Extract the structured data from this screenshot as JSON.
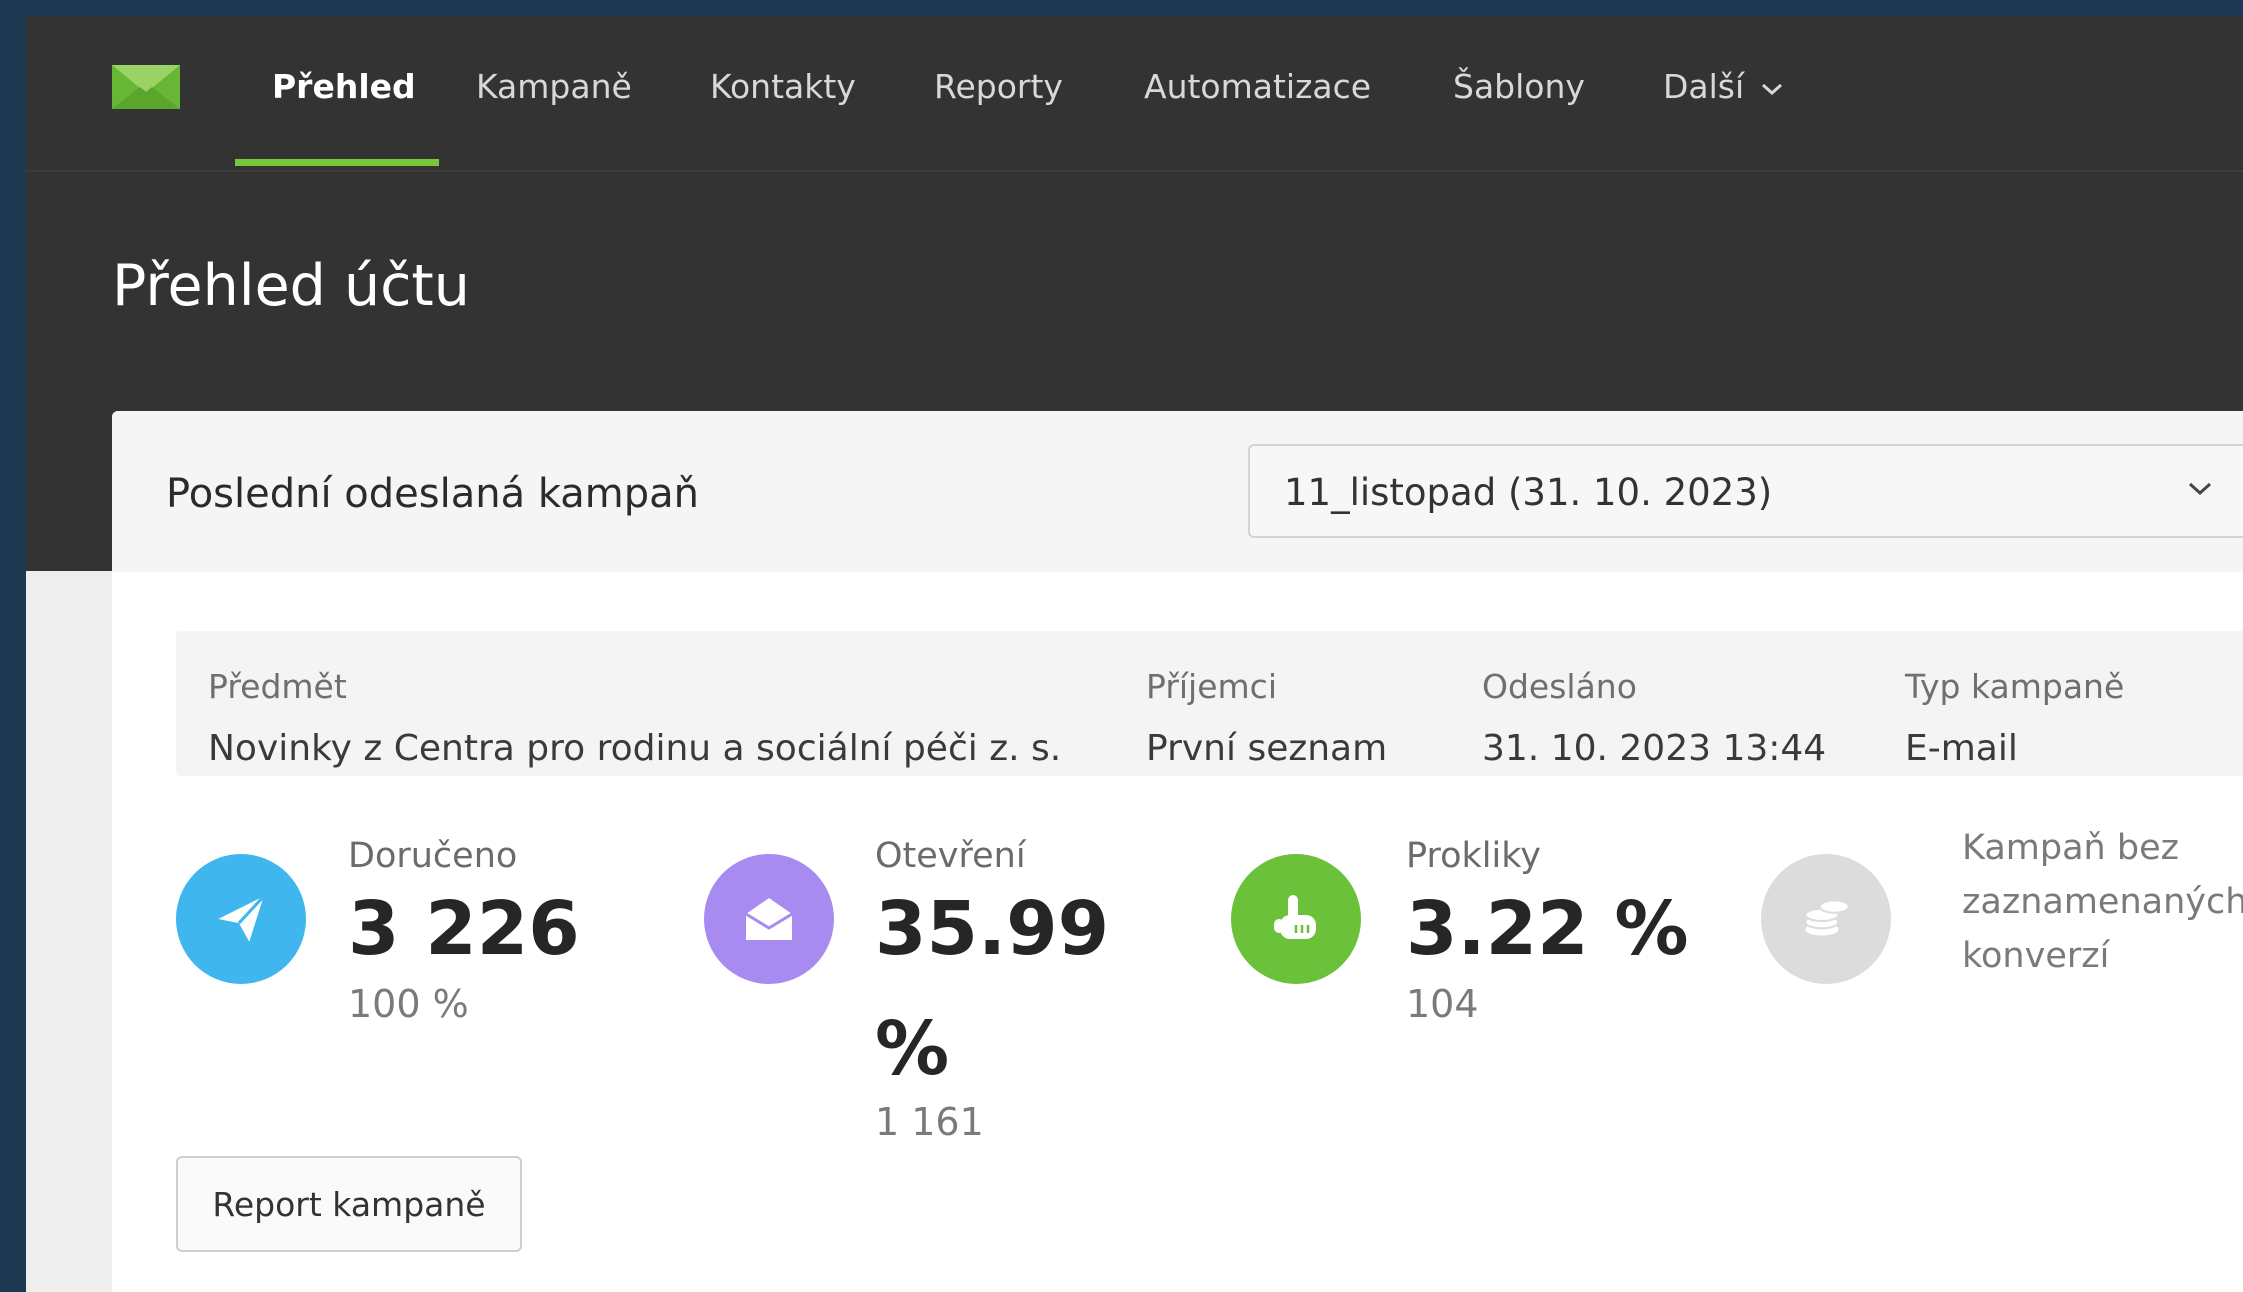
{
  "nav": {
    "items": [
      {
        "label": "Přehled",
        "active": true
      },
      {
        "label": "Kampaně"
      },
      {
        "label": "Kontakty"
      },
      {
        "label": "Reporty"
      },
      {
        "label": "Automatizace"
      },
      {
        "label": "Šablony"
      },
      {
        "label": "Další"
      }
    ],
    "accent_color": "#78c63b"
  },
  "page": {
    "title": "Přehled účtu"
  },
  "campaign": {
    "section_title": "Poslední odeslaná kampaň",
    "selected": "11_listopad (31. 10. 2023)",
    "info": {
      "subject_label": "Předmět",
      "subject": "Novinky z Centra pro rodinu a sociální péči z. s.",
      "recipients_label": "Příjemci",
      "recipients": "První seznam",
      "sent_label": "Odesláno",
      "sent": "31. 10. 2023 13:44",
      "type_label": "Typ kampaně",
      "type": "E-mail"
    },
    "stats": {
      "delivered": {
        "label": "Doručeno",
        "value": "3 226",
        "sub": "100 %",
        "icon": "paper-plane-icon",
        "color": "#3fb6ee"
      },
      "opens": {
        "label": "Otevření",
        "value": "35.99 %",
        "sub": "1 161",
        "icon": "open-envelope-icon",
        "color": "#a78bf0"
      },
      "clicks": {
        "label": "Prokliky",
        "value": "3.22 %",
        "sub": "104",
        "icon": "pointer-hand-icon",
        "color": "#6cc13a"
      },
      "conversions": {
        "text": "Kampaň bez zaznamenaných konverzí",
        "icon": "coins-icon",
        "color": "#dcdcdc"
      }
    },
    "report_button": "Report kampaně"
  }
}
